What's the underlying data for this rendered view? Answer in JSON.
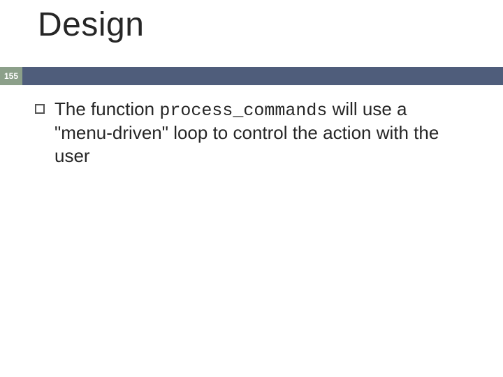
{
  "slide": {
    "title": "Design",
    "page_number": "155",
    "bullets": [
      {
        "text_before": "The function ",
        "code": "process_commands",
        "text_after": " will use a \"menu-driven\" loop to control the action with the user"
      }
    ]
  }
}
